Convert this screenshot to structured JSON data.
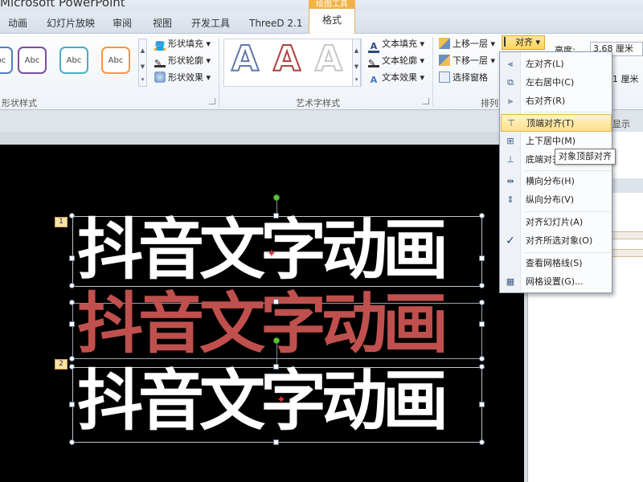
{
  "app": {
    "title": "Microsoft PowerPoint",
    "context_tab_group": "绘图工具"
  },
  "tabs": [
    "动画",
    "幻灯片放映",
    "审阅",
    "视图",
    "开发工具",
    "ThreeD 2.1"
  ],
  "active_tab": "格式",
  "ribbon": {
    "shape_styles": {
      "group_label": "形状样式",
      "swatch_label": "Abc",
      "swatch_colors": [
        "#7a4ea0",
        "#4bacc6",
        "#f79646"
      ],
      "commands": [
        "形状填充",
        "形状轮廓",
        "形状效果"
      ]
    },
    "wordart_styles": {
      "group_label": "艺术字样式",
      "glyph": "A",
      "commands": [
        "文本填充",
        "文本轮廓",
        "文本效果"
      ]
    },
    "arrange": {
      "group_label_partial": "排列",
      "commands": [
        "上移一层",
        "下移一层",
        "选择窗格"
      ],
      "align_button": "对齐"
    },
    "size": {
      "height_label": "高度:",
      "height_value": "3.68 厘米",
      "width_partial": "1 厘米"
    }
  },
  "pane": {
    "show_label": "显示"
  },
  "align_menu": {
    "items": [
      {
        "label": "左对齐(L)",
        "icon": "align-left-icon"
      },
      {
        "label": "左右居中(C)",
        "icon": "align-center-icon"
      },
      {
        "label": "右对齐(R)",
        "icon": "align-right-icon"
      },
      {
        "label": "顶端对齐(T)",
        "icon": "align-top-icon"
      },
      {
        "label": "上下居中(M)",
        "icon": "align-middle-icon"
      },
      {
        "label": "底端对齐(B)",
        "icon": "align-bottom-icon"
      },
      {
        "label": "横向分布(H)",
        "icon": "distribute-horizontal-icon"
      },
      {
        "label": "纵向分布(V)",
        "icon": "distribute-vertical-icon"
      },
      {
        "label": "对齐幻灯片(A)",
        "icon": ""
      },
      {
        "label": "对齐所选对象(O)",
        "icon": "checkmark-icon"
      },
      {
        "label": "查看网格线(S)",
        "icon": ""
      },
      {
        "label": "网格设置(G)...",
        "icon": "grid-icon"
      }
    ],
    "highlighted": "顶端对齐(T)",
    "tooltip": "对象顶部对齐"
  },
  "slide": {
    "text": "抖音文字动画",
    "objects": [
      "1",
      "2"
    ],
    "colors": {
      "white": "#ffffff",
      "red": "#c0504d"
    }
  }
}
